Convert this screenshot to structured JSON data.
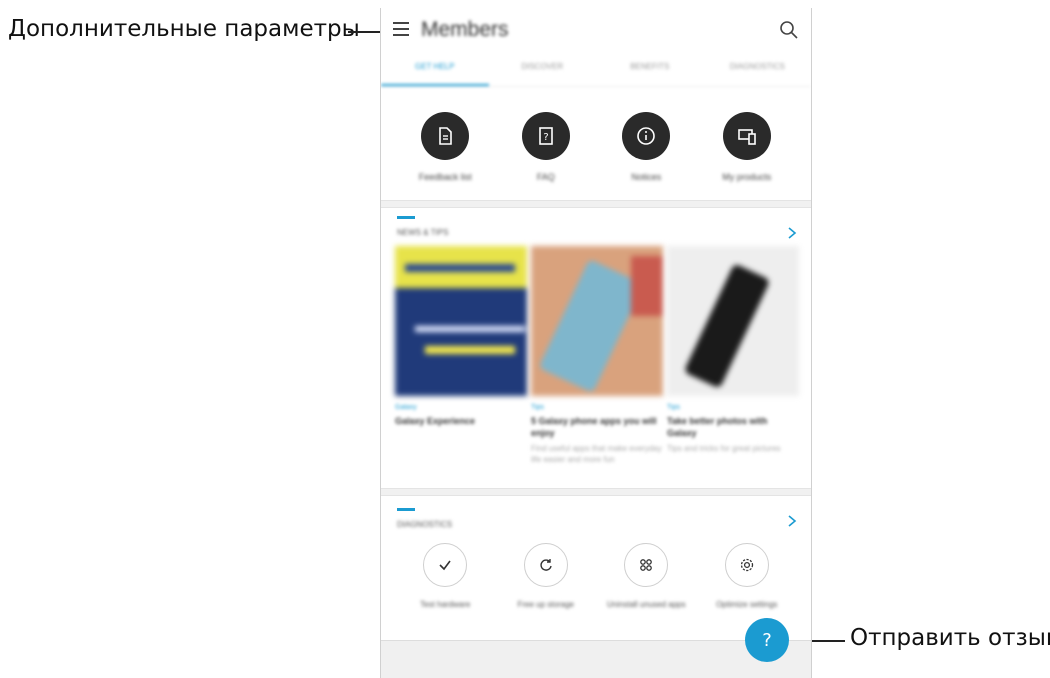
{
  "callouts": {
    "more_options": "Дополнительные параметры",
    "send_feedback": "Отправить отзыв"
  },
  "header": {
    "title": "Members",
    "menu_icon": "hamburger-menu-icon",
    "search_icon": "search-icon"
  },
  "tabs": [
    {
      "label": "Get help",
      "active": true
    },
    {
      "label": "Discover",
      "active": false
    },
    {
      "label": "Benefits",
      "active": false
    },
    {
      "label": "Diagnostics",
      "active": false
    }
  ],
  "quick_actions": [
    {
      "label": "Feedback list",
      "icon": "document-icon"
    },
    {
      "label": "FAQ",
      "icon": "help-book-icon"
    },
    {
      "label": "Notices",
      "icon": "info-icon"
    },
    {
      "label": "My products",
      "icon": "devices-icon"
    }
  ],
  "news_section": {
    "title": "News & tips",
    "cards": [
      {
        "category": "Galaxy",
        "title": "Galaxy Experience",
        "desc": ""
      },
      {
        "category": "Tips",
        "title": "5 Galaxy phone apps you will enjoy",
        "desc": "Find useful apps that make everyday life easier and more fun"
      },
      {
        "category": "Tips",
        "title": "Take better photos with Galaxy",
        "desc": "Tips and tricks for great pictures"
      }
    ]
  },
  "diagnostics_section": {
    "title": "Diagnostics",
    "items": [
      {
        "label": "Test hardware",
        "icon": "checkmark-icon"
      },
      {
        "label": "Free up storage",
        "icon": "refresh-icon"
      },
      {
        "label": "Uninstall unused apps",
        "icon": "apps-grid-icon"
      },
      {
        "label": "Optimize settings",
        "icon": "gear-icon"
      }
    ]
  },
  "fab": {
    "label": "?",
    "icon": "question-mark-icon"
  },
  "colors": {
    "accent": "#1b9bd1",
    "dark_circle": "#2a2a2a"
  }
}
